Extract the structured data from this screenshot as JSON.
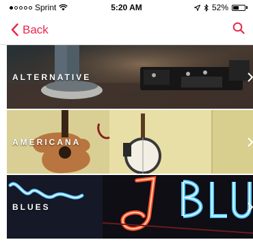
{
  "status_bar": {
    "carrier": "Sprint",
    "time": "5:20 AM",
    "battery": "52%",
    "battery_level": 0.52
  },
  "nav": {
    "back_label": "Back",
    "accent_color": "#e8274a"
  },
  "genres": [
    {
      "label": "ALTERNATIVE"
    },
    {
      "label": "AMERICANA"
    },
    {
      "label": "BLUES"
    }
  ]
}
